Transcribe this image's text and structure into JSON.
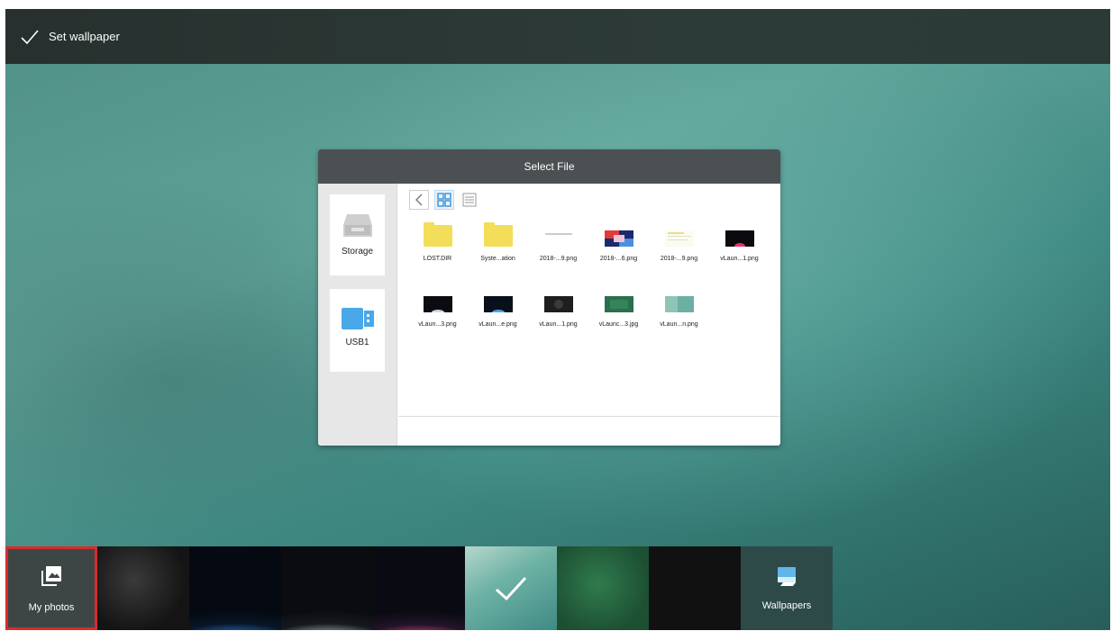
{
  "topbar": {
    "title": "Set wallpaper",
    "icon": "check-icon"
  },
  "dialog": {
    "title": "Select File",
    "sidebar": [
      {
        "label": "Storage",
        "icon": "storage-tray-icon"
      },
      {
        "label": "USB1",
        "icon": "usb-drive-icon"
      }
    ],
    "toolbar": {
      "back_icon": "chevron-left-icon",
      "grid_icon": "grid-view-icon",
      "list_icon": "list-view-icon"
    },
    "files": [
      {
        "name": "LOST.DIR",
        "type": "folder"
      },
      {
        "name": "Syste...ation",
        "type": "folder"
      },
      {
        "name": "2018-...9.png",
        "type": "image",
        "thumb": "line"
      },
      {
        "name": "2018-...6.png",
        "type": "image",
        "thumb": "colorful"
      },
      {
        "name": "2018-...9.png",
        "type": "image",
        "thumb": "light"
      },
      {
        "name": "vLaun...1.png",
        "type": "image",
        "thumb": "dark-red"
      },
      {
        "name": "vLaun...3.png",
        "type": "image",
        "thumb": "dark-blue"
      },
      {
        "name": "vLaun...e.png",
        "type": "image",
        "thumb": "dark-blue"
      },
      {
        "name": "vLaun...1.png",
        "type": "image",
        "thumb": "dark-gray"
      },
      {
        "name": "vLaunc...3.jpg",
        "type": "image",
        "thumb": "green"
      },
      {
        "name": "vLaun...n.png",
        "type": "image",
        "thumb": "teal"
      }
    ]
  },
  "strip": {
    "my_photos": "My photos",
    "wallpapers": "Wallpapers"
  },
  "colors": {
    "dialog_header": "#4b5053",
    "folder": "#f2de58",
    "selection_border": "#d92b2b",
    "grid_active": "#3a8fd8"
  }
}
